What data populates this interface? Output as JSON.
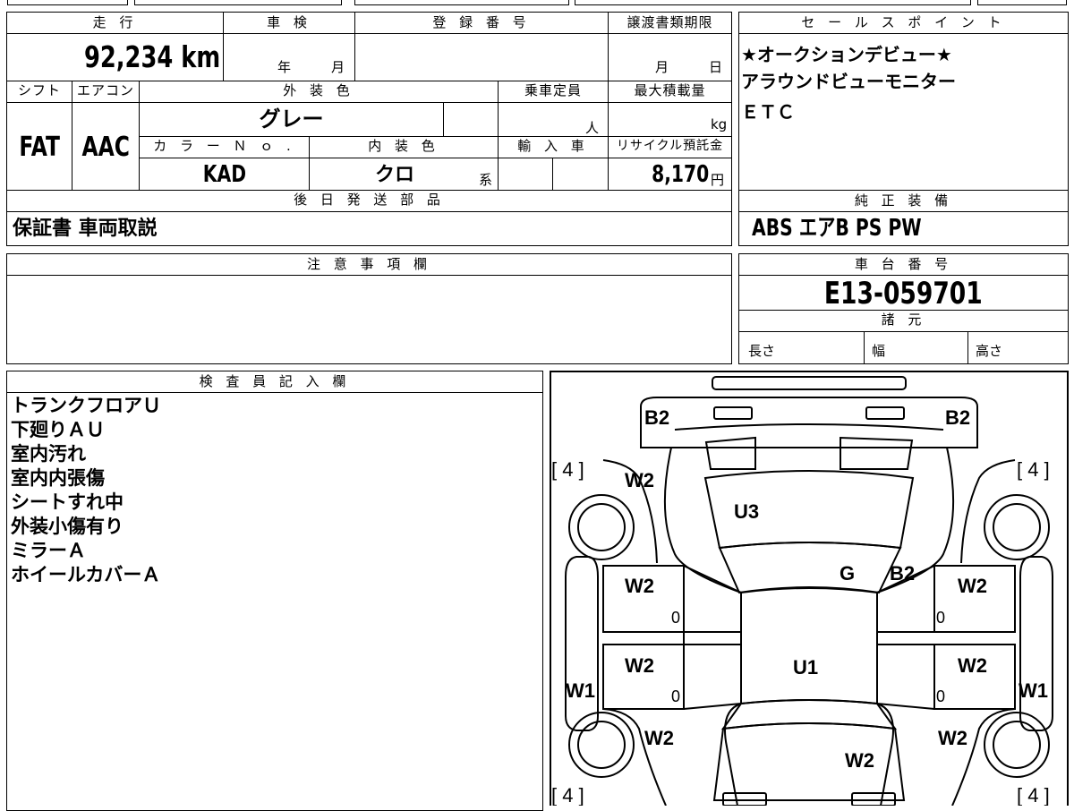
{
  "mileage": {
    "label": "走 行",
    "value": "92,234",
    "unit": "km"
  },
  "shaken": {
    "label": "車 検",
    "year_unit": "年",
    "month_unit": "月"
  },
  "registration_number": {
    "label": "登 録 番 号"
  },
  "transfer_deadline": {
    "label": "譲渡書類期限",
    "month_unit": "月",
    "day_unit": "日"
  },
  "sales_points": {
    "label": "セ ー ル ス ポ イ ン ト",
    "lines": [
      "★オークションデビュー★",
      "アラウンドビューモニター",
      "ＥＴＣ"
    ]
  },
  "shift": {
    "label": "シフト",
    "value": "FAT"
  },
  "aircon": {
    "label": "エアコン",
    "value": "AAC"
  },
  "exterior_color": {
    "label": "外 装 色",
    "value": "グレー"
  },
  "capacity": {
    "label": "乗車定員",
    "unit": "人"
  },
  "max_load": {
    "label": "最大積載量",
    "unit": "kg"
  },
  "color_no": {
    "label": "カ ラ ー Ｎ ｏ .",
    "value": "KAD"
  },
  "interior_color": {
    "label": "内 装 色",
    "value": "クロ",
    "suffix": "系"
  },
  "import": {
    "label": "輸 入 車"
  },
  "recycle": {
    "label": "リサイクル預託金",
    "value": "8,170",
    "unit": "円"
  },
  "later_parts": {
    "label": "後 日 発 送 部 品",
    "value": "保証書 車両取説"
  },
  "genuine_equipment": {
    "label": "純 正 装 備",
    "value": "ABS エアB PS PW"
  },
  "notes": {
    "label": "注 意 事 項 欄"
  },
  "chassis_number": {
    "label": "車 台 番 号",
    "value": "E13-059701"
  },
  "specs": {
    "label": "諸 元",
    "length": "長さ",
    "width": "幅",
    "height": "高さ"
  },
  "inspector": {
    "label": "検 査 員 記 入 欄",
    "lines": [
      "トランクフロアＵ",
      "下廻りＡＵ",
      "室内汚れ",
      "室内内張傷",
      "シートすれ中",
      "外装小傷有り",
      "ミラーＡ",
      "ホイールカバーＡ"
    ]
  },
  "diagram": {
    "marks": {
      "b2_rear_left": "B2",
      "b2_rear_right": "B2",
      "tire_rl": "[ 4 ]",
      "tire_rr": "[ 4 ]",
      "tire_fl": "[ 4 ]",
      "tire_fr": "[ 4 ]",
      "w2_rear_quarter_left": "W2",
      "u3_trunk": "U3",
      "g_rear_glass": "G",
      "b2_roof": "B2",
      "w2_rear_door_left": "W2",
      "w2_rear_door_right": "W2",
      "w2_front_door_left": "W2",
      "w2_front_door_right": "W2",
      "u1_roof": "U1",
      "w1_left": "W1",
      "w1_right": "W1",
      "w2_front_fender_left": "W2",
      "w2_front_fender_right": "W2",
      "w2_hood": "W2",
      "zero_rl": "0",
      "zero_rr": "0",
      "zero_fl": "0",
      "zero_fr": "0"
    }
  }
}
